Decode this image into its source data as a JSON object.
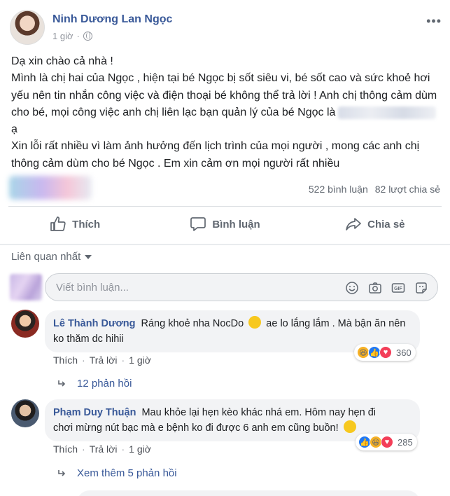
{
  "post": {
    "author": "Ninh Dương Lan Ngọc",
    "time": "1 giờ",
    "text_lines": [
      "Dạ xin chào cả nhà !",
      "Mình là chị hai của Ngọc , hiện tại bé Ngọc bị sốt siêu vi, bé sốt cao và sức khoẻ hơi yếu nên tin nhắn công việc và điện thoại bé không thể trả lời ! Anh chị thông cảm dùm cho bé, mọi công việc anh chị liên lạc bạn quản lý của bé Ngọc là",
      "ạ",
      "Xin lỗi rất nhiều vì làm ảnh hưởng đến lịch trình của mọi người , mong các anh chị thông cảm dùm cho bé Ngọc . Em xin cảm ơn mọi người rất nhiều"
    ],
    "comments_count": "522 bình luận",
    "shares_count": "82 lượt chia sẻ"
  },
  "actions": {
    "like": "Thích",
    "comment": "Bình luận",
    "share": "Chia sẻ"
  },
  "sort_label": "Liên quan nhất",
  "comment_input": {
    "placeholder": "Viết bình luận..."
  },
  "comments": [
    {
      "name": "Lê Thành Dương",
      "text_before_emoji": "Ráng khoẻ nha NocDo",
      "text_after_emoji": "ae lo lắng lắm . Mà bận ăn nên ko thăm dc hihii",
      "like": "Thích",
      "reply": "Trả lời",
      "time": "1 giờ",
      "reaction_count": "360",
      "replies_label": "12 phản hồi"
    },
    {
      "name": "Phạm Duy Thuận",
      "text_line1": "Mau khỏe lại hẹn kèo khác nhá em. Hôm nay hẹn đi",
      "text_line2": "chơi mừng nút bạc mà e bệnh ko đi được 6 anh em cũng buồn!",
      "like": "Thích",
      "reply": "Trả lời",
      "time": "1 giờ",
      "reaction_count": "285",
      "replies_label": "Xem thêm 5 phản hồi"
    }
  ],
  "colors": {
    "link": "#385898",
    "muted": "#606770",
    "bubble": "#f2f3f5"
  }
}
